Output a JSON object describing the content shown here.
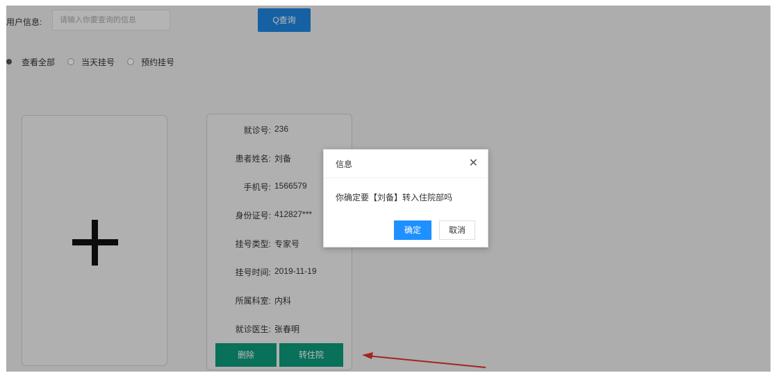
{
  "search": {
    "label": "用户信息:",
    "placeholder": "请输入你要查询的信息",
    "button": "Q查询"
  },
  "filters": {
    "options": [
      "查看全部",
      "当天挂号",
      "预约挂号"
    ]
  },
  "add_card": {
    "icon": "plus-icon"
  },
  "patient_card": {
    "fields": [
      {
        "label": "就诊号:",
        "value": "236"
      },
      {
        "label": "患者姓名:",
        "value": "刘备"
      },
      {
        "label": "手机号:",
        "value": "1566579"
      },
      {
        "label": "身份证号:",
        "value": "412827***"
      },
      {
        "label": "挂号类型:",
        "value": "专家号"
      },
      {
        "label": "挂号时间:",
        "value": "2019-11-19"
      },
      {
        "label": "所属科室:",
        "value": "内科"
      },
      {
        "label": "就诊医生:",
        "value": "张春明"
      }
    ],
    "delete_button": "删除",
    "transfer_button": "转住院"
  },
  "dialog": {
    "title": "信息",
    "message": "你确定要【刘备】转入住院部吗",
    "confirm": "确定",
    "cancel": "取消"
  },
  "colors": {
    "primary_blue": "#1f86e0",
    "teal": "#0d9a7a",
    "arrow_red": "#e03030"
  }
}
